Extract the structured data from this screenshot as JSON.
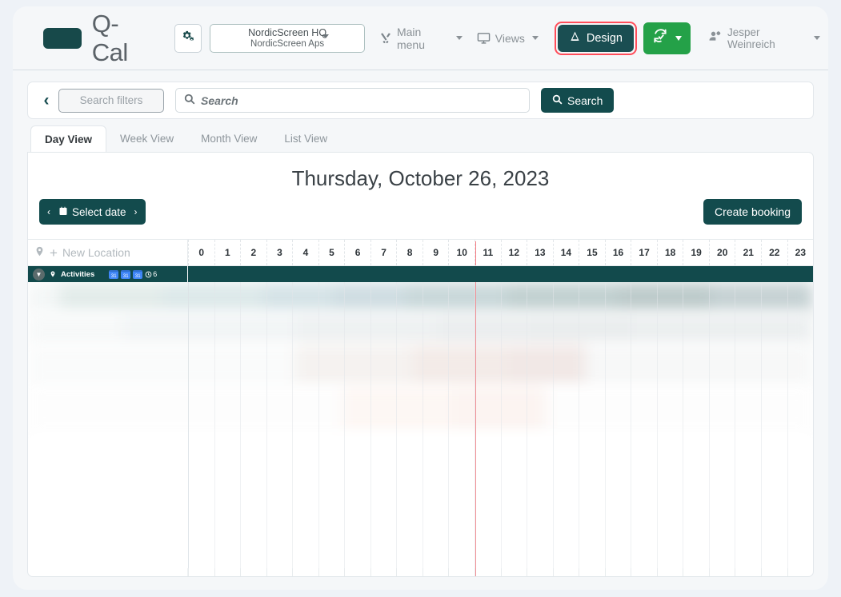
{
  "brand": {
    "name": "Q-Cal",
    "logo_icon": "q-cal-logo-mark",
    "accent": "#17494a"
  },
  "header": {
    "settings_icon": "gears-icon",
    "org": {
      "name": "NordicScreen HQ",
      "sub": "NordicScreen Aps"
    },
    "main_menu": {
      "label": "Main menu",
      "icon": "tools-icon"
    },
    "views": {
      "label": "Views",
      "icon": "monitor-icon"
    },
    "design": {
      "label": "Design",
      "icon": "design-ruler-icon",
      "highlighted": true,
      "highlight_color": "#ff4d5a",
      "bg": "#1a4e52"
    },
    "sync": {
      "icon": "sync-check-icon",
      "bg": "#24a148"
    },
    "user": {
      "name": "Jesper Weinreich",
      "icon": "user-gear-icon"
    }
  },
  "search": {
    "back_icon": "chevron-left-icon",
    "filters_label": "Search filters",
    "placeholder": "Search",
    "input_value": "",
    "search_icon": "search-icon",
    "search_button_label": "Search"
  },
  "tabs": [
    {
      "label": "Day View",
      "active": true
    },
    {
      "label": "Week View",
      "active": false
    },
    {
      "label": "Month View",
      "active": false
    },
    {
      "label": "List View",
      "active": false
    }
  ],
  "calendar": {
    "title": "Thursday, October 26, 2023",
    "prev_label": "‹",
    "next_label": "›",
    "select_date_label": "Select date",
    "select_date_icon": "calendar-icon",
    "create_booking_label": "Create booking",
    "new_location_label": "New Location",
    "new_location_pin_icon": "map-pin-icon",
    "new_location_plus_icon": "plus-icon",
    "hours": [
      "0",
      "1",
      "2",
      "3",
      "4",
      "5",
      "6",
      "7",
      "8",
      "9",
      "10",
      "11",
      "12",
      "13",
      "14",
      "15",
      "16",
      "17",
      "18",
      "19",
      "20",
      "21",
      "22",
      "23"
    ],
    "current_time_hour": 11,
    "group_row": {
      "collapse_icon": "chevron-down-circle-icon",
      "pin_icon": "map-pin-icon",
      "label": "Activities",
      "badges": [
        "31",
        "31",
        "31"
      ],
      "clock_icon": "clock-icon",
      "clock_value": "6",
      "bg": "#124a4c"
    },
    "body_state": "blurred"
  }
}
